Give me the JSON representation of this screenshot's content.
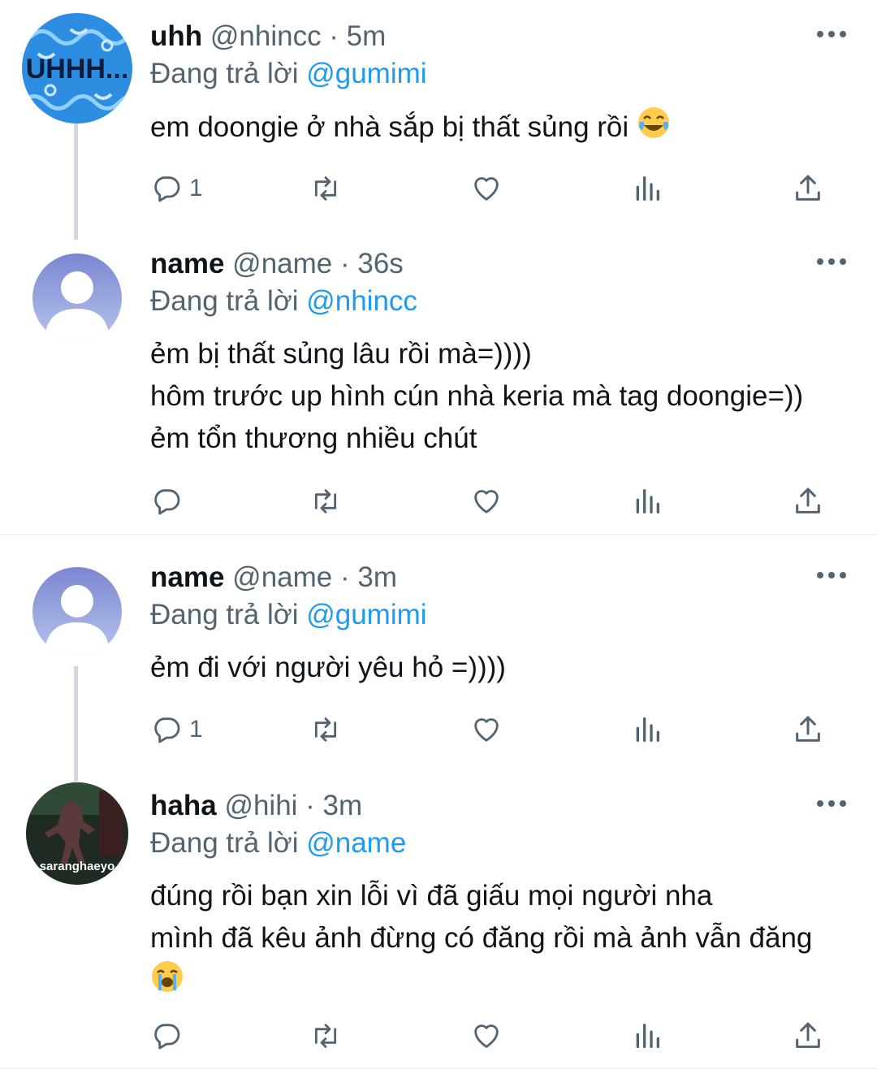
{
  "tweets": [
    {
      "display_name": "uhh",
      "meta": "@nhincc · 5m",
      "replying_prefix": "Đang trả lời",
      "replying_to": "@gumimi",
      "lines": [
        "em doongie ở nhà sắp bị thất sủng rồi"
      ],
      "emoji": "face-with-tears-of-joy",
      "avatar_text": "UHHH...",
      "reply_count": "1"
    },
    {
      "display_name": "name",
      "meta": "@name · 36s",
      "replying_prefix": "Đang trả lời",
      "replying_to": "@nhincc",
      "lines": [
        "ẻm bị thất sủng lâu rồi mà=))))",
        "hôm trước up hình cún nhà keria mà tag doongie=))",
        "ẻm tổn thương nhiều chút"
      ],
      "reply_count": ""
    },
    {
      "display_name": "name",
      "meta": "@name · 3m",
      "replying_prefix": "Đang trả lời",
      "replying_to": "@gumimi",
      "lines": [
        "ẻm đi với người yêu hỏ =))))"
      ],
      "reply_count": "1"
    },
    {
      "display_name": "haha",
      "meta": "@hihi · 3m",
      "replying_prefix": "Đang trả lời",
      "replying_to": "@name",
      "lines": [
        "đúng rồi bạn xin lỗi vì đã giấu mọi người nha",
        "mình đã kêu ảnh đừng có đăng rồi mà ảnh vẫn đăng"
      ],
      "emoji": "loudly-crying-face",
      "avatar_text": "saranghaeyo",
      "reply_count": ""
    }
  ],
  "colors": {
    "link": "#1d9bf0",
    "secondary": "#536471",
    "thread_line": "#cfd9de",
    "divider": "#eff3f4"
  },
  "icons": [
    "reply-icon",
    "retweet-icon",
    "like-icon",
    "views-icon",
    "share-icon",
    "more-icon"
  ]
}
